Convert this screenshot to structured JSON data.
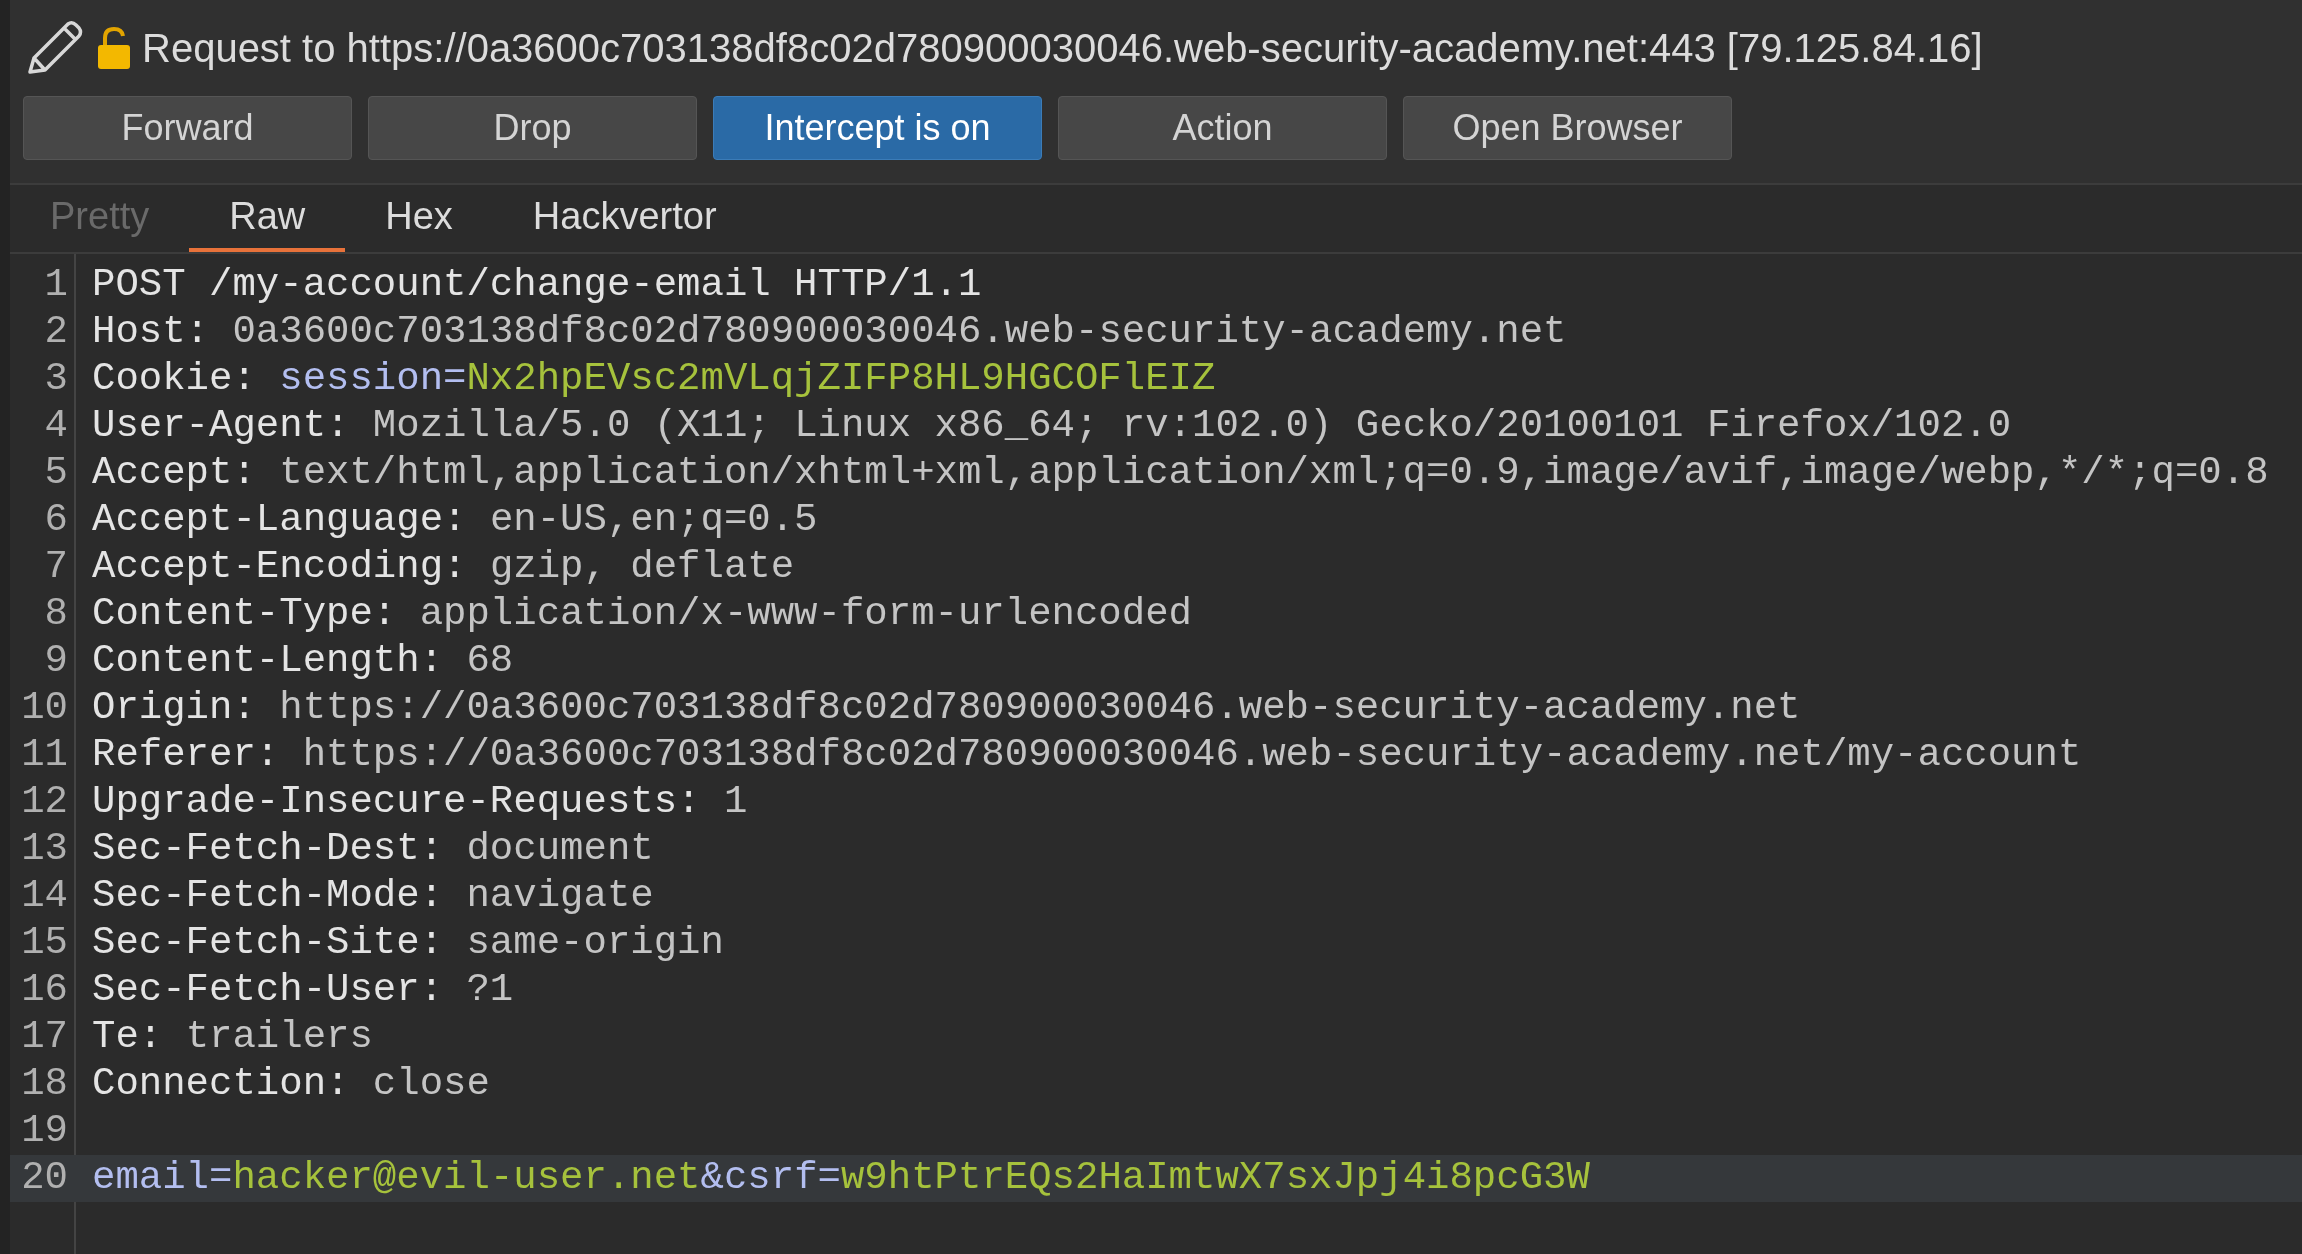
{
  "request_bar": {
    "title": "Request to https://0a3600c703138df8c02d780900030046.web-security-academy.net:443  [79.125.84.16]"
  },
  "buttons": [
    {
      "label": "Forward",
      "active": false
    },
    {
      "label": "Drop",
      "active": false
    },
    {
      "label": "Intercept is on",
      "active": true
    },
    {
      "label": "Action",
      "active": false
    },
    {
      "label": "Open Browser",
      "active": false
    }
  ],
  "tabs": [
    {
      "label": "Pretty",
      "selected": false,
      "disabled": true
    },
    {
      "label": "Raw",
      "selected": true,
      "disabled": false
    },
    {
      "label": "Hex",
      "selected": false,
      "disabled": false
    },
    {
      "label": "Hackvertor",
      "selected": false,
      "disabled": false
    }
  ],
  "editor": {
    "lines": [
      {
        "number": "1",
        "selected": false,
        "segments": [
          {
            "kind": "name",
            "text": "POST /my-account/change-email HTTP/1.1"
          }
        ]
      },
      {
        "number": "2",
        "selected": false,
        "segments": [
          {
            "kind": "name",
            "text": "Host: "
          },
          {
            "kind": "value",
            "text": "0a3600c703138df8c02d780900030046.web-security-academy.net"
          }
        ]
      },
      {
        "number": "3",
        "selected": false,
        "segments": [
          {
            "kind": "name",
            "text": "Cookie: "
          },
          {
            "kind": "param",
            "text": "session="
          },
          {
            "kind": "param_value",
            "text": "Nx2hpEVsc2mVLqjZIFP8HL9HGCOFlEIZ"
          }
        ]
      },
      {
        "number": "4",
        "selected": false,
        "segments": [
          {
            "kind": "name",
            "text": "User-Agent: "
          },
          {
            "kind": "value",
            "text": "Mozilla/5.0 (X11; Linux x86_64; rv:102.0) Gecko/20100101 Firefox/102.0"
          }
        ]
      },
      {
        "number": "5",
        "selected": false,
        "segments": [
          {
            "kind": "name",
            "text": "Accept: "
          },
          {
            "kind": "value",
            "text": "text/html,application/xhtml+xml,application/xml;q=0.9,image/avif,image/webp,*/*;q=0.8"
          }
        ]
      },
      {
        "number": "6",
        "selected": false,
        "segments": [
          {
            "kind": "name",
            "text": "Accept-Language: "
          },
          {
            "kind": "value",
            "text": "en-US,en;q=0.5"
          }
        ]
      },
      {
        "number": "7",
        "selected": false,
        "segments": [
          {
            "kind": "name",
            "text": "Accept-Encoding: "
          },
          {
            "kind": "value",
            "text": "gzip, deflate"
          }
        ]
      },
      {
        "number": "8",
        "selected": false,
        "segments": [
          {
            "kind": "name",
            "text": "Content-Type: "
          },
          {
            "kind": "value",
            "text": "application/x-www-form-urlencoded"
          }
        ]
      },
      {
        "number": "9",
        "selected": false,
        "segments": [
          {
            "kind": "name",
            "text": "Content-Length: "
          },
          {
            "kind": "value",
            "text": "68"
          }
        ]
      },
      {
        "number": "10",
        "selected": false,
        "segments": [
          {
            "kind": "name",
            "text": "Origin: "
          },
          {
            "kind": "value",
            "text": "https://0a3600c703138df8c02d780900030046.web-security-academy.net"
          }
        ]
      },
      {
        "number": "11",
        "selected": false,
        "segments": [
          {
            "kind": "name",
            "text": "Referer: "
          },
          {
            "kind": "value",
            "text": "https://0a3600c703138df8c02d780900030046.web-security-academy.net/my-account"
          }
        ]
      },
      {
        "number": "12",
        "selected": false,
        "segments": [
          {
            "kind": "name",
            "text": "Upgrade-Insecure-Requests: "
          },
          {
            "kind": "value",
            "text": "1"
          }
        ]
      },
      {
        "number": "13",
        "selected": false,
        "segments": [
          {
            "kind": "name",
            "text": "Sec-Fetch-Dest: "
          },
          {
            "kind": "value",
            "text": "document"
          }
        ]
      },
      {
        "number": "14",
        "selected": false,
        "segments": [
          {
            "kind": "name",
            "text": "Sec-Fetch-Mode: "
          },
          {
            "kind": "value",
            "text": "navigate"
          }
        ]
      },
      {
        "number": "15",
        "selected": false,
        "segments": [
          {
            "kind": "name",
            "text": "Sec-Fetch-Site: "
          },
          {
            "kind": "value",
            "text": "same-origin"
          }
        ]
      },
      {
        "number": "16",
        "selected": false,
        "segments": [
          {
            "kind": "name",
            "text": "Sec-Fetch-User: "
          },
          {
            "kind": "value",
            "text": "?1"
          }
        ]
      },
      {
        "number": "17",
        "selected": false,
        "segments": [
          {
            "kind": "name",
            "text": "Te: "
          },
          {
            "kind": "value",
            "text": "trailers"
          }
        ]
      },
      {
        "number": "18",
        "selected": false,
        "segments": [
          {
            "kind": "name",
            "text": "Connection: "
          },
          {
            "kind": "value",
            "text": "close"
          }
        ]
      },
      {
        "number": "19",
        "selected": false
      },
      {
        "number": "20",
        "selected": true,
        "segments": [
          {
            "kind": "param",
            "text": "email="
          },
          {
            "kind": "param_value",
            "text": "hacker@evil-user.net"
          },
          {
            "kind": "param",
            "text": "&csrf="
          },
          {
            "kind": "param_value",
            "text": "w9htPtrEQs2HaImtwX7sxJpj4i8pcG3W"
          }
        ]
      }
    ]
  }
}
